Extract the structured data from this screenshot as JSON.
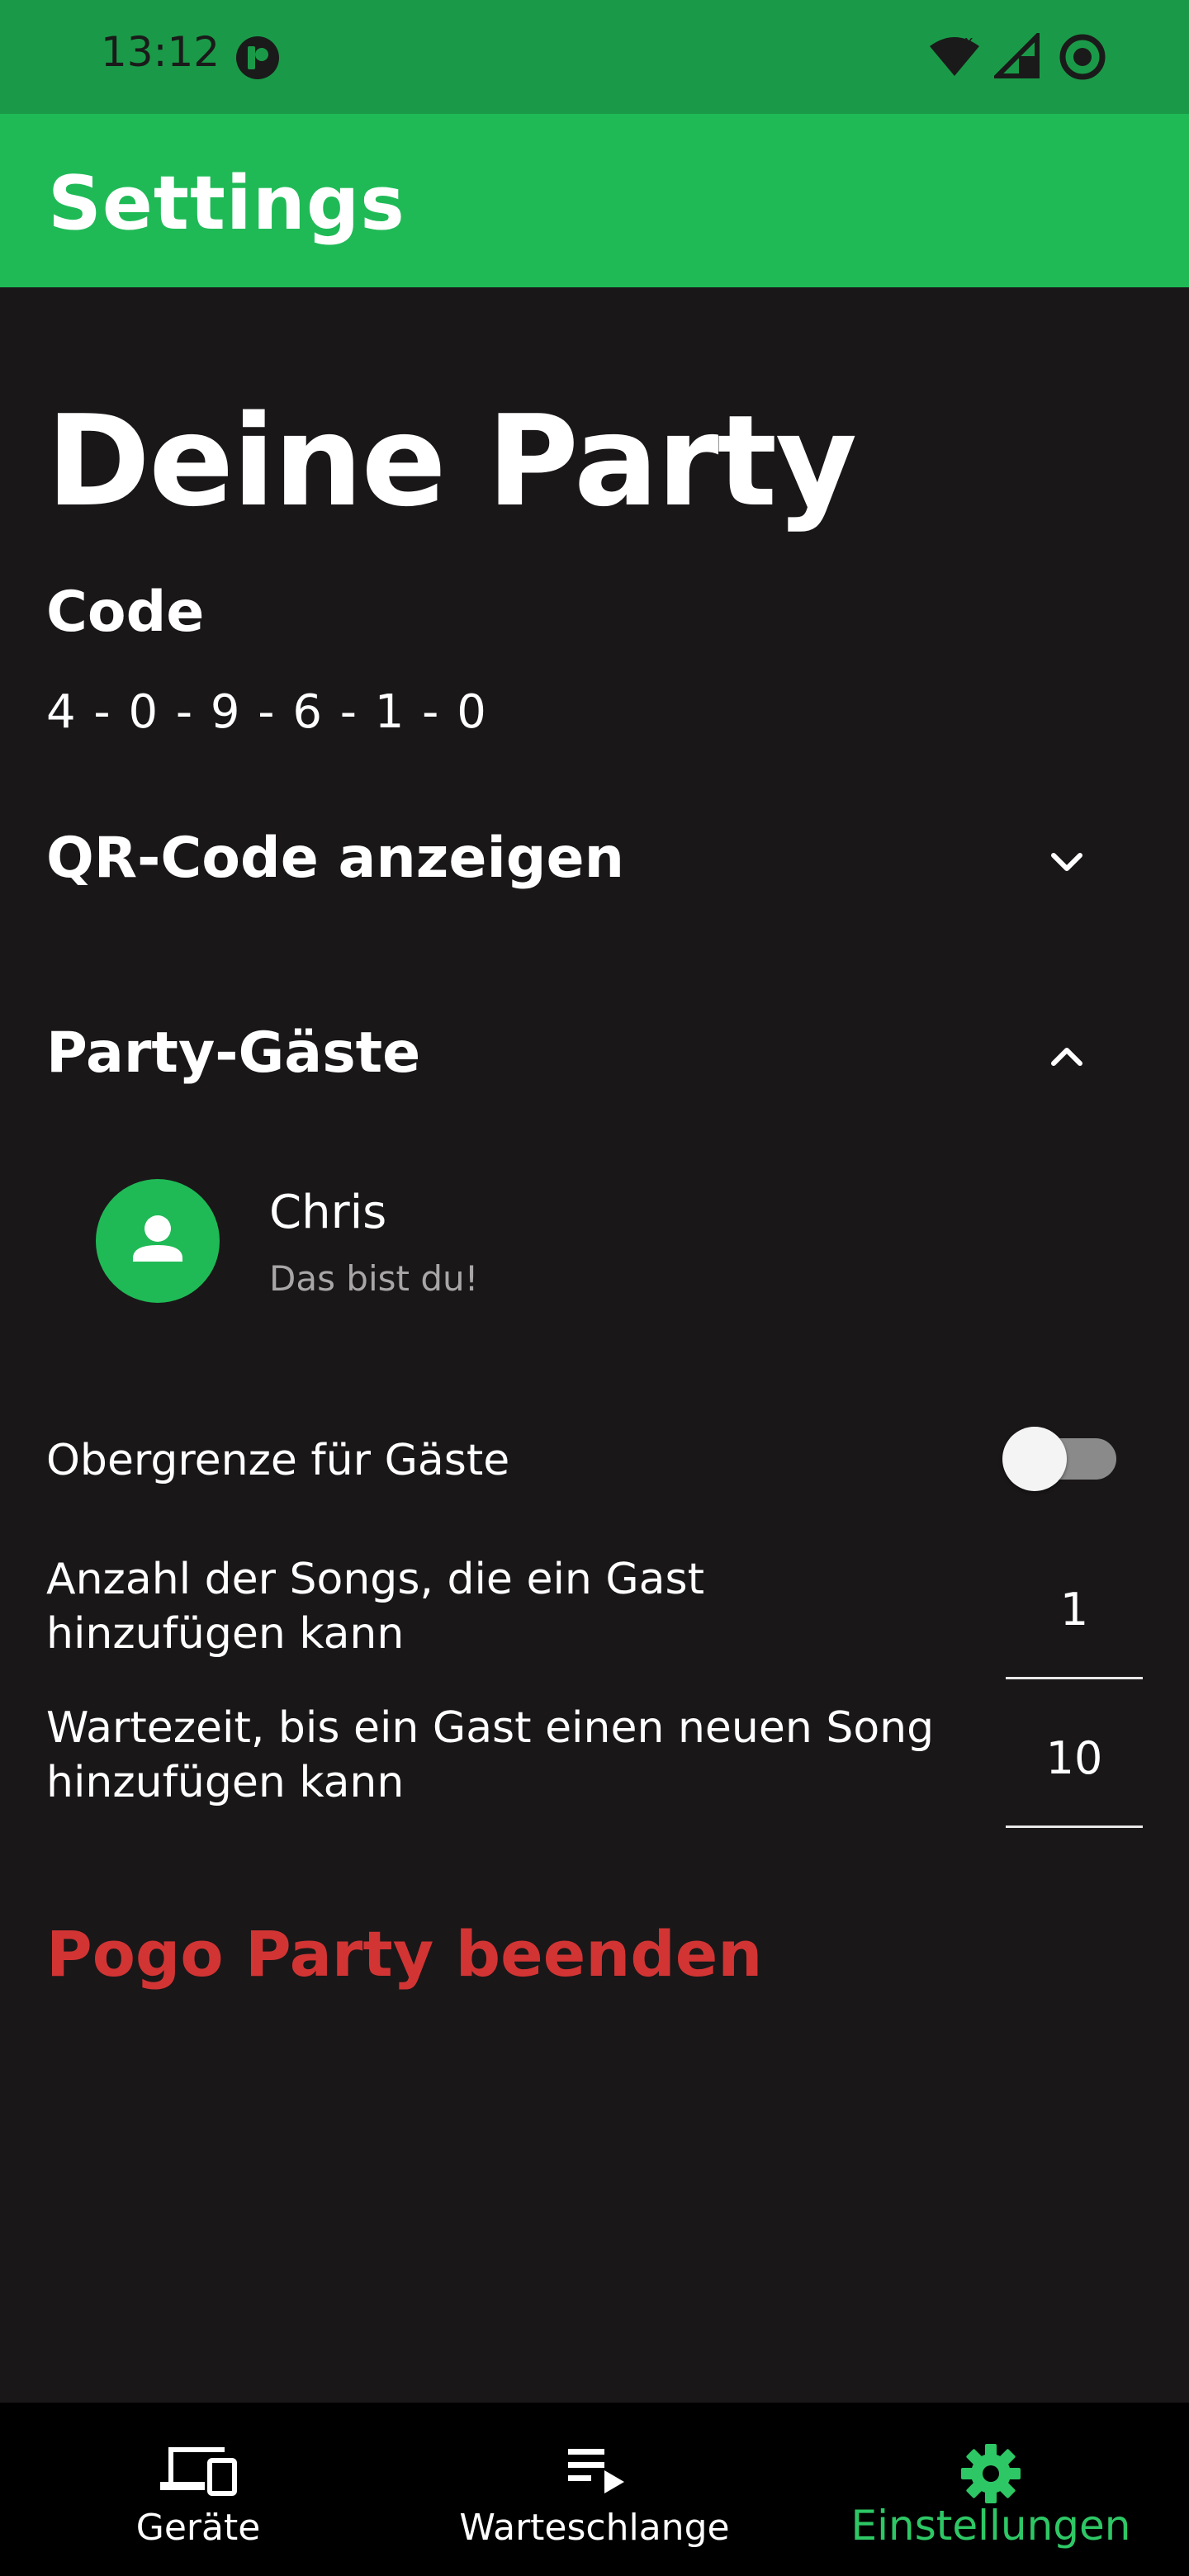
{
  "status_bar": {
    "time": "13:12"
  },
  "app_bar": {
    "title": "Settings"
  },
  "party": {
    "heading": "Deine Party",
    "code_label": "Code",
    "code_value": "4 - 0 - 9 - 6 - 1 - 0"
  },
  "sections": {
    "qr_code": "QR-Code anzeigen",
    "guests": "Party-Gäste"
  },
  "guests": [
    {
      "name": "Chris",
      "subtitle": "Das bist du!",
      "icon": "person-icon"
    }
  ],
  "settings": {
    "guest_limit_label": "Obergrenze für Gäste",
    "guest_limit_enabled": false,
    "songs_per_guest_label_line1": "Anzahl der Songs, die ein Gast",
    "songs_per_guest_label_line2": "hinzufügen kann",
    "songs_per_guest_value": "1",
    "wait_time_label_line1": "Wartezeit, bis ein Gast einen neuen Song",
    "wait_time_label_line2": "hinzufügen kann",
    "wait_time_value": "10"
  },
  "end_party": "Pogo Party beenden",
  "bottom_nav": {
    "items": [
      {
        "label": "Geräte",
        "icon": "devices-icon",
        "active": false
      },
      {
        "label": "Warteschlange",
        "icon": "queue-icon",
        "active": false
      },
      {
        "label": "Einstellungen",
        "icon": "gear-icon",
        "active": true
      }
    ]
  },
  "colors": {
    "status_bar": "#1a9a48",
    "app_bar": "#1fba56",
    "background": "#1a1718",
    "accent": "#2ec765",
    "danger": "#d23434"
  }
}
